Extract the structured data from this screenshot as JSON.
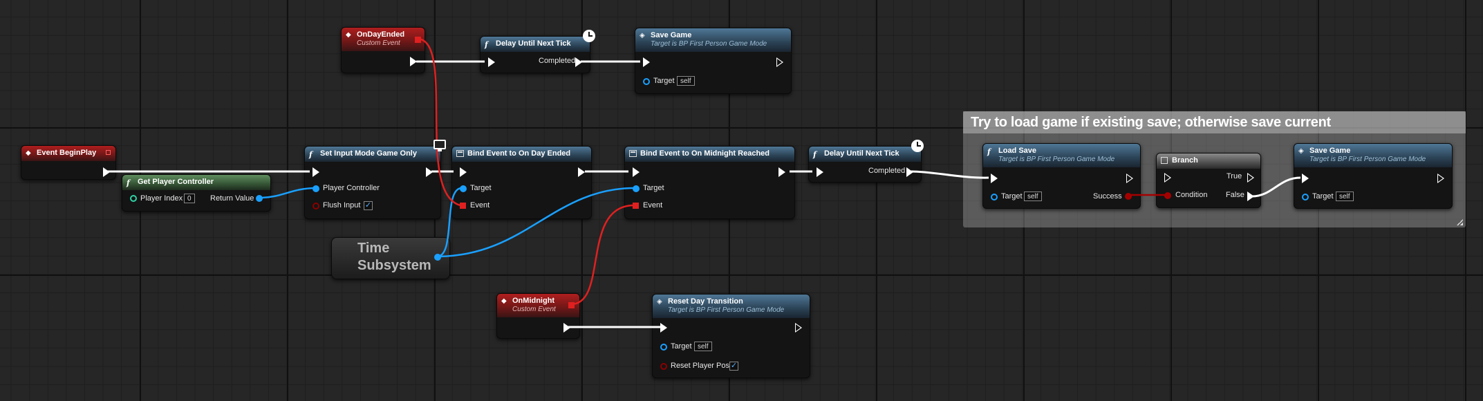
{
  "comment": {
    "title": "Try to load game if existing save; otherwise save current"
  },
  "nodes": {
    "event_begin_play": {
      "title": "Event BeginPlay"
    },
    "get_player_controller": {
      "title": "Get Player Controller",
      "player_index_label": "Player Index",
      "player_index_value": "0",
      "return_value_label": "Return Value"
    },
    "set_input_mode": {
      "title": "Set Input Mode Game Only",
      "player_controller_label": "Player Controller",
      "flush_input_label": "Flush Input",
      "flush_input_checked": "✓"
    },
    "bind_day_ended": {
      "title": "Bind Event to On Day Ended",
      "target_label": "Target",
      "event_label": "Event"
    },
    "bind_midnight": {
      "title": "Bind Event to On Midnight Reached",
      "target_label": "Target",
      "event_label": "Event"
    },
    "delay_top": {
      "title": "Delay Until Next Tick",
      "completed_label": "Completed"
    },
    "delay_mid": {
      "title": "Delay Until Next Tick",
      "completed_label": "Completed"
    },
    "on_day_ended": {
      "title": "OnDayEnded",
      "subtitle": "Custom Event"
    },
    "save_game_top": {
      "title": "Save Game",
      "subtitle": "Target is BP First Person Game Mode",
      "target_label": "Target",
      "target_value": "self"
    },
    "load_save": {
      "title": "Load Save",
      "subtitle": "Target is BP First Person Game Mode",
      "target_label": "Target",
      "target_value": "self",
      "success_label": "Success"
    },
    "branch": {
      "title": "Branch",
      "true_label": "True",
      "false_label": "False",
      "condition_label": "Condition"
    },
    "save_game_right": {
      "title": "Save Game",
      "subtitle": "Target is BP First Person Game Mode",
      "target_label": "Target",
      "target_value": "self"
    },
    "time_subsystem": {
      "line1": "Time",
      "line2": "Subsystem"
    },
    "on_midnight": {
      "title": "OnMidnight",
      "subtitle": "Custom Event"
    },
    "reset_day": {
      "title": "Reset Day Transition",
      "subtitle": "Target is BP First Person Game Mode",
      "target_label": "Target",
      "target_value": "self",
      "reset_pos_label": "Reset Player Pos",
      "reset_pos_checked": "✓"
    }
  },
  "colors": {
    "exec_wire": "#ffffff",
    "object_wire": "#1aa0ff",
    "delegate_wire": "#e02020",
    "bool_wire": "#a50000"
  }
}
